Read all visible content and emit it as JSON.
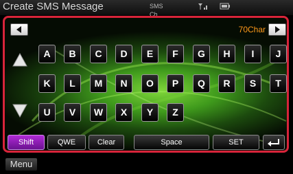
{
  "header": {
    "title": "Create SMS Message",
    "status_text": "SMS Ch"
  },
  "keyboard": {
    "char_remaining": "70Char",
    "row1": [
      "A",
      "B",
      "C",
      "D",
      "E",
      "F",
      "G",
      "H",
      "I",
      "J"
    ],
    "row2": [
      "K",
      "L",
      "M",
      "N",
      "O",
      "P",
      "Q",
      "R",
      "S",
      "T"
    ],
    "row3": [
      "U",
      "V",
      "W",
      "X",
      "Y",
      "Z"
    ],
    "function_keys": {
      "shift": "Shift",
      "qwe": "QWE",
      "clear": "Clear",
      "space": "Space",
      "set": "SET"
    }
  },
  "footer": {
    "menu": "Menu"
  },
  "colors": {
    "panel_border": "#d8243a",
    "char_count": "#ff9a1a",
    "shift_active": "#b02ad6"
  },
  "icons": {
    "cursor_left": "triangle-left-icon",
    "cursor_right": "triangle-right-icon",
    "scroll_up": "triangle-up-icon",
    "scroll_down": "triangle-down-icon",
    "backspace": "return-arrow-icon"
  }
}
